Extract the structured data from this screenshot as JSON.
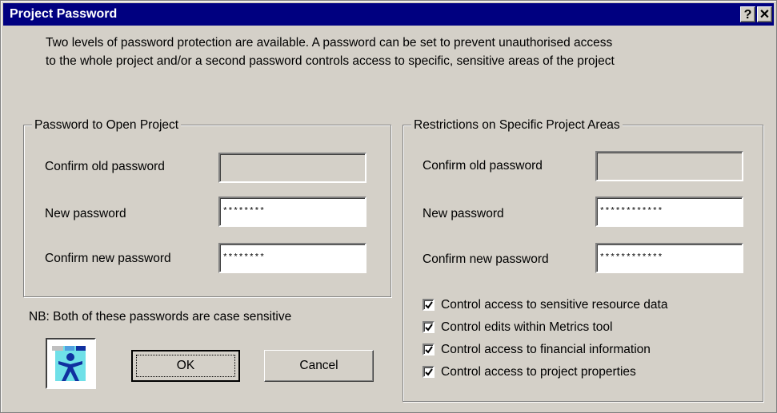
{
  "window": {
    "title": "Project Password",
    "help_glyph": "?",
    "close_glyph": "✕"
  },
  "intro": {
    "line1": "Two levels of password protection are available. A password can be set to prevent unauthorised access",
    "line2": "to the whole project and/or a second password controls access to specific, sensitive areas of the project"
  },
  "open_project": {
    "legend": "Password to Open Project",
    "old_label": "Confirm old password",
    "old_value": "",
    "new_label": "New password",
    "new_value": "********",
    "confirm_label": "Confirm new password",
    "confirm_value": "********"
  },
  "restrictions": {
    "legend": "Restrictions on Specific Project Areas",
    "old_label": "Confirm old password",
    "old_value": "",
    "new_label": "New password",
    "new_value": "************",
    "confirm_label": "Confirm new password",
    "confirm_value": "************",
    "options": [
      {
        "label": "Control access to sensitive resource data",
        "checked": true
      },
      {
        "label": "Control edits within Metrics tool",
        "checked": true
      },
      {
        "label": "Control access to financial information",
        "checked": true
      },
      {
        "label": "Control access to project properties",
        "checked": true
      }
    ]
  },
  "note": "NB: Both of these passwords are case sensitive",
  "buttons": {
    "ok": "OK",
    "cancel": "Cancel"
  },
  "colors": {
    "titlebar": "#000080",
    "face": "#d4d0c8",
    "logo_figure": "#1030a0",
    "logo_bg": "#6fe0e8"
  },
  "icons": {
    "logo": "project-person-logo-icon",
    "check": "checkmark-icon"
  }
}
